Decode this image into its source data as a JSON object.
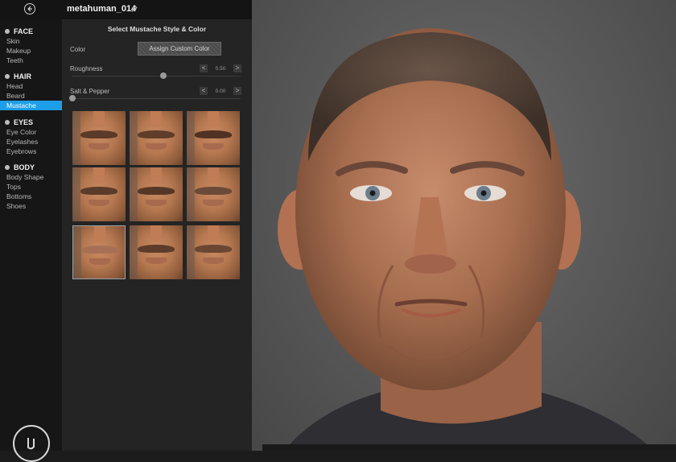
{
  "header": {
    "back_icon": "arrow-left-icon",
    "project_name": "metahuman_014",
    "edit_icon": "pencil-icon"
  },
  "sidebar": {
    "sections": [
      {
        "label": "FACE",
        "icon": "face-icon",
        "items": [
          "Skin",
          "Makeup",
          "Teeth"
        ]
      },
      {
        "label": "HAIR",
        "icon": "hair-icon",
        "items": [
          "Head",
          "Beard",
          "Mustache"
        ]
      },
      {
        "label": "EYES",
        "icon": "eye-icon",
        "items": [
          "Eye Color",
          "Eyelashes",
          "Eyebrows"
        ]
      },
      {
        "label": "BODY",
        "icon": "body-icon",
        "items": [
          "Body Shape",
          "Tops",
          "Bottoms",
          "Shoes"
        ]
      }
    ],
    "active_item": "Mustache",
    "logo": "unreal-engine-logo"
  },
  "panel": {
    "title": "Select Mustache Style & Color",
    "color_label": "Color",
    "assign_button": "Assign Custom Color",
    "roughness": {
      "label": "Roughness",
      "value": "0.50",
      "fraction": 0.5
    },
    "salt_pepper": {
      "label": "Salt & Pepper",
      "value": "0.00",
      "fraction": 0.0
    },
    "step_left": "<",
    "step_right": ">",
    "styles_selected_index": 6,
    "styles_count": 9
  },
  "viewport": {
    "description_icon": "metahuman-face-preview"
  },
  "colors": {
    "accent": "#1e9ee8",
    "sidebar_bg": "#161616",
    "panel_bg": "#242424"
  }
}
